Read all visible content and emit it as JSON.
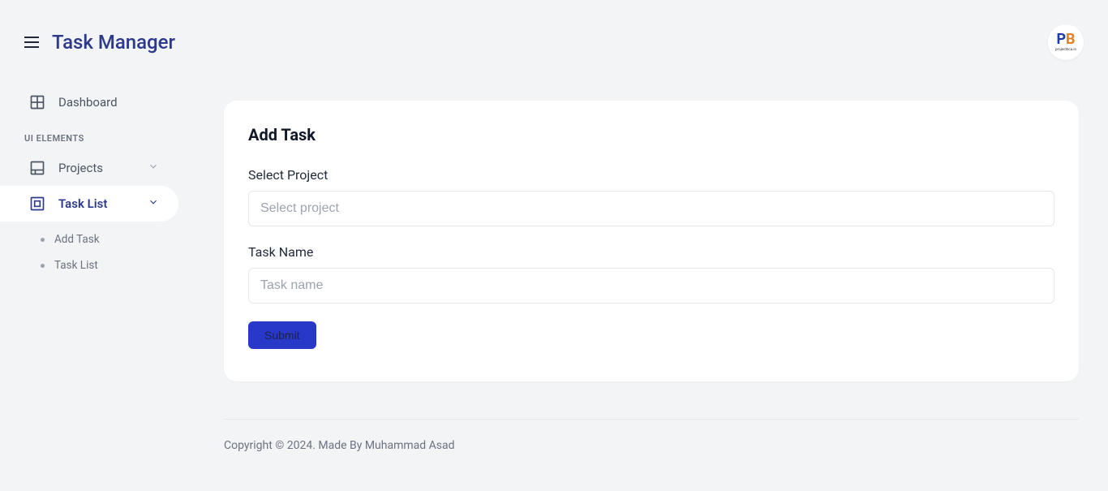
{
  "app": {
    "title": "Task Manager"
  },
  "logo": {
    "p": "P",
    "b": "B",
    "subtext": "projectbca.in"
  },
  "sidebar": {
    "dashboard": "Dashboard",
    "section_ui": "UI ELEMENTS",
    "projects": "Projects",
    "task_list": "Task List",
    "sub_add_task": "Add Task",
    "sub_task_list": "Task List"
  },
  "card": {
    "title": "Add Task",
    "label_project": "Select Project",
    "placeholder_project": "Select project",
    "label_task": "Task Name",
    "placeholder_task": "Task name",
    "submit": "Submit"
  },
  "footer": {
    "text": "Copyright © 2024. Made By Muhammad Asad"
  }
}
